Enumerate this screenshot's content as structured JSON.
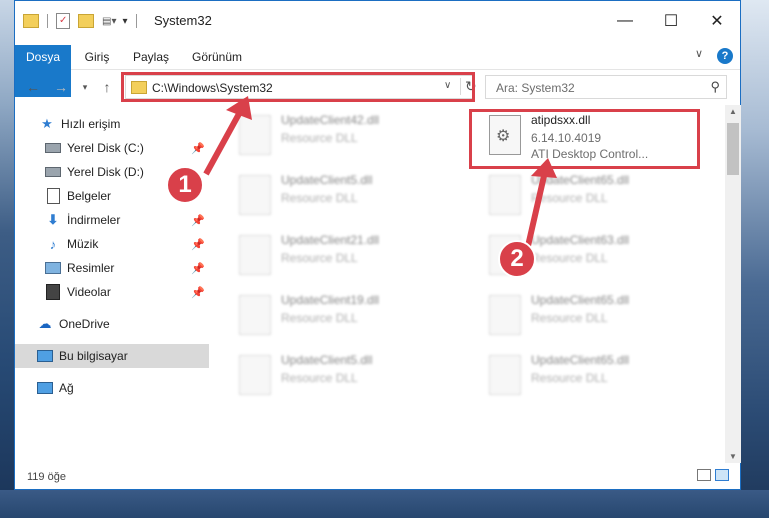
{
  "window": {
    "title": "System32",
    "controls": {
      "minimize": "—",
      "maximize": "☐",
      "close": "✕"
    }
  },
  "ribbon": {
    "tabs": [
      "Dosya",
      "Giriş",
      "Paylaş",
      "Görünüm"
    ]
  },
  "address": {
    "path": "C:\\Windows\\System32",
    "search_placeholder": "Ara: System32"
  },
  "sidebar": {
    "items": [
      {
        "label": "Hızlı erişim",
        "icon": "star-icon",
        "pinned": false
      },
      {
        "label": "Yerel Disk (C:)",
        "icon": "drive-icon",
        "pinned": true
      },
      {
        "label": "Yerel Disk (D:)",
        "icon": "drive-icon",
        "pinned": false
      },
      {
        "label": "Belgeler",
        "icon": "documents-icon",
        "pinned": false
      },
      {
        "label": "İndirmeler",
        "icon": "download-icon",
        "pinned": true
      },
      {
        "label": "Müzik",
        "icon": "music-icon",
        "pinned": true
      },
      {
        "label": "Resimler",
        "icon": "pictures-icon",
        "pinned": true
      },
      {
        "label": "Videolar",
        "icon": "videos-icon",
        "pinned": true
      },
      {
        "label": "OneDrive",
        "icon": "cloud-icon",
        "pinned": false
      },
      {
        "label": "Bu bilgisayar",
        "icon": "computer-icon",
        "pinned": false,
        "selected": true
      },
      {
        "label": "Ağ",
        "icon": "network-icon",
        "pinned": false
      }
    ]
  },
  "files": {
    "highlighted": {
      "name": "atipdsxx.dll",
      "version": "6.14.10.4019",
      "description": "ATI Desktop Control..."
    },
    "background": [
      {
        "name": "UpdateClient42.dll",
        "type": "Resource DLL"
      },
      {
        "name": "UpdateClient5.dll",
        "type": "Resource DLL"
      },
      {
        "name": "UpdateClient65.dll",
        "type": "Resource DLL"
      },
      {
        "name": "UpdateClient21.dll",
        "type": "Resource DLL"
      },
      {
        "name": "UpdateClient63.dll",
        "type": "Resource DLL"
      },
      {
        "name": "UpdateClient19.dll",
        "type": "Resource DLL"
      },
      {
        "name": "UpdateClient65.dll",
        "type": "Resource DLL"
      },
      {
        "name": "UpdateClient5.dll",
        "type": "Resource DLL"
      },
      {
        "name": "UpdateClient65.dll",
        "type": "Resource DLL"
      }
    ]
  },
  "status": {
    "count": "119 öğe"
  },
  "annotations": {
    "step1": "1",
    "step2": "2"
  },
  "colors": {
    "accent": "#1979ca",
    "highlight": "#d9404a"
  }
}
